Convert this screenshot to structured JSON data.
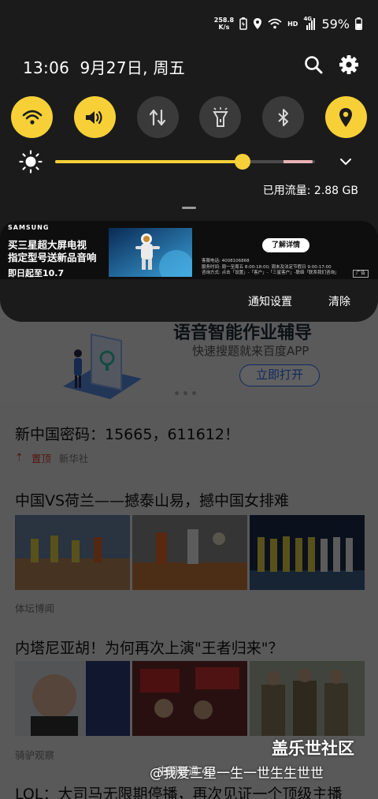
{
  "status_bar": {
    "net_speed_value": "258.8",
    "net_speed_unit": "K/s",
    "battery_percent": "59%",
    "lte_label": "4G",
    "hd_label": "HD"
  },
  "header": {
    "time": "13:06",
    "date": "9月27日, 周五"
  },
  "quick_settings": [
    {
      "name": "wifi-icon",
      "on": true
    },
    {
      "name": "sound-icon",
      "on": true
    },
    {
      "name": "mobile-data-icon",
      "on": false
    },
    {
      "name": "flashlight-icon",
      "on": false
    },
    {
      "name": "bluetooth-icon",
      "on": false
    },
    {
      "name": "location-icon",
      "on": true
    }
  ],
  "brightness": {
    "level": 0.72,
    "auto_tail_end": 0.99
  },
  "data_usage": "已用流量: 2.88 GB",
  "notification": {
    "brand": "SAMSUNG",
    "line1": "买三星超大屏电视",
    "line2": "指定型号送新品音响",
    "date": "即日起至10.7",
    "more_button": "了解详情",
    "fine_print": [
      "客服电话: 4008106868",
      "服务时间: 周一至周五 8:00-18:00; 周末及法定节假日 9:00-17:00",
      "咨询方式: 点击「设置」-「客户」-「三星客户」-联络「联系我们咨询」"
    ],
    "ad_tag": "广告"
  },
  "actions": {
    "settings": "通知设置",
    "clear": "清除"
  },
  "background_app": {
    "banner": {
      "title": "语音智能作业辅导",
      "subtitle": "快速搜题就来百度APP",
      "button": "立即打开"
    },
    "news": [
      {
        "title": "新中国密码：15665，611612！",
        "pin": "置顶",
        "source": "新华社"
      },
      {
        "title": "中国VS荷兰——撼泰山易，撼中国女排难",
        "source": "体坛博闻"
      },
      {
        "title": "内塔尼亚胡！为何再次上演\"王者归来\"？",
        "source": "骑驴观察"
      },
      {
        "title": "LOL：大司马无限期停播，再次见证一个顶级主播"
      }
    ]
  },
  "watermark": {
    "site": "盖乐世社区",
    "user": "@我爱三星一生一世生生世世",
    "bottom_caption": "中国联通 4G"
  },
  "colors": {
    "accent_yellow": "#f7d038",
    "shade_bg": "#1b1b1b",
    "tile_off": "#3a3a3a"
  }
}
